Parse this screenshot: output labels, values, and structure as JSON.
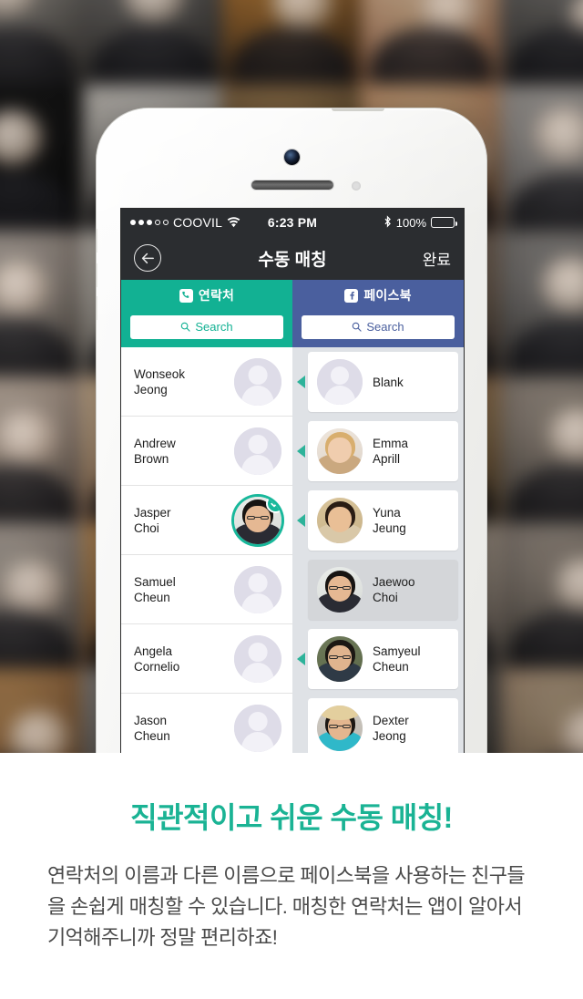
{
  "statusbar": {
    "carrier": "COOVIL",
    "signal_dots_filled": 3,
    "signal_dots_total": 5,
    "wifi_icon": "wifi-icon",
    "time": "6:23 PM",
    "bluetooth_icon": "bluetooth-icon",
    "battery_percent": "100%",
    "battery_level": 100
  },
  "navbar": {
    "back_icon": "back-arrow-icon",
    "title": "수동 매칭",
    "done_label": "완료"
  },
  "tabs": [
    {
      "id": "contacts",
      "label": "연락처",
      "icon": "phone-icon",
      "color": "#12b193",
      "active": true
    },
    {
      "id": "facebook",
      "label": "페이스북",
      "icon": "facebook-icon",
      "color": "#4a5f9e",
      "active": false
    }
  ],
  "search": [
    {
      "id": "contacts-search",
      "placeholder": "Search",
      "value": "",
      "icon": "search-icon",
      "color": "#12b193"
    },
    {
      "id": "facebook-search",
      "placeholder": "Search",
      "value": "",
      "icon": "search-icon",
      "color": "#4a5f9e"
    }
  ],
  "contacts_list": [
    {
      "first": "Wonseok",
      "last": "Jeong",
      "avatar": "placeholder",
      "selected": false
    },
    {
      "first": "Andrew",
      "last": "Brown",
      "avatar": "placeholder",
      "selected": false
    },
    {
      "first": "Jasper",
      "last": "Choi",
      "avatar": "photo-man-glasses-suit",
      "selected": true
    },
    {
      "first": "Samuel",
      "last": "Cheun",
      "avatar": "placeholder",
      "selected": false
    },
    {
      "first": "Angela",
      "last": "Cornelio",
      "avatar": "placeholder",
      "selected": false
    },
    {
      "first": "Jason",
      "last": "Cheun",
      "avatar": "placeholder",
      "selected": false
    }
  ],
  "facebook_list": [
    {
      "first": "Blank",
      "last": "",
      "avatar": "placeholder",
      "arrow": true,
      "matched": false
    },
    {
      "first": "Emma",
      "last": "Aprill",
      "avatar": "photo-blonde-woman",
      "arrow": true,
      "matched": false
    },
    {
      "first": "Yuna",
      "last": "Jeung",
      "avatar": "photo-child",
      "arrow": true,
      "matched": false
    },
    {
      "first": "Jaewoo",
      "last": "Choi",
      "avatar": "photo-man-glasses-suit",
      "arrow": false,
      "matched": true
    },
    {
      "first": "Samyeul",
      "last": "Cheun",
      "avatar": "photo-man-glasses-outdoor",
      "arrow": true,
      "matched": false
    },
    {
      "first": "Dexter",
      "last": "Jeong",
      "avatar": "photo-man-straw-hat",
      "arrow": false,
      "matched": false
    }
  ],
  "caption": {
    "headline": "직관적이고 쉬운 수동 매칭!",
    "body": "연락처의 이름과 다른 이름으로 페이스북을 사용하는 친구들을 손쉽게 매칭할 수 있습니다. 매칭한 연락처는 앱이 알아서 기억해주니까 정말 편리하죠!"
  },
  "colors": {
    "accent_green": "#1ab394",
    "tab_green": "#12b193",
    "facebook_blue": "#4a5f9e",
    "navbar_dark": "#2b2d30",
    "body_text": "#4a4a4a",
    "list_bg": "#dfe2e6",
    "matched_card": "#d4d6d9"
  }
}
